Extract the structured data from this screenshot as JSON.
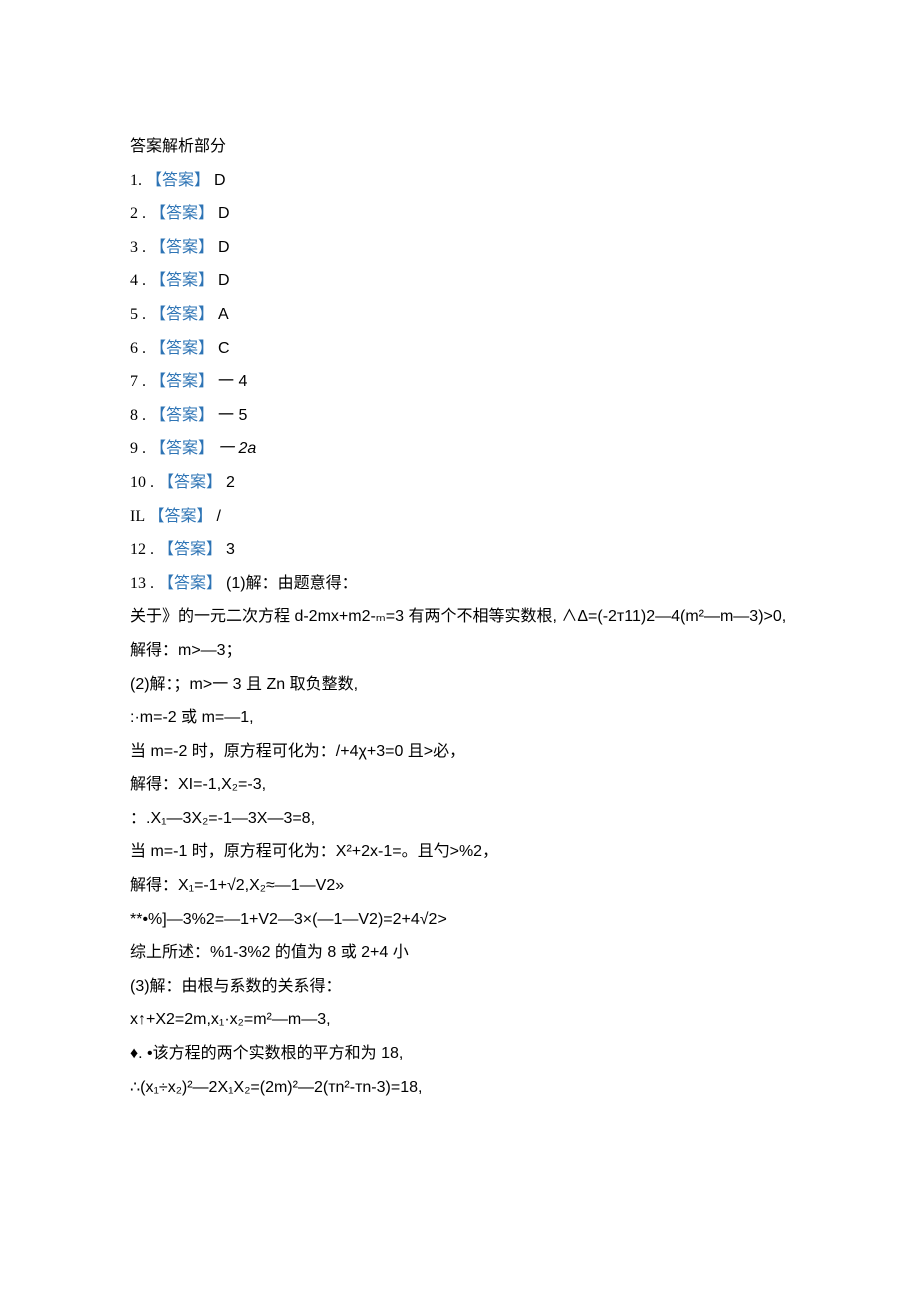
{
  "sectionTitle": "答案解析部分",
  "answers": [
    {
      "num": "1.",
      "label": "【答案】",
      "value": "D"
    },
    {
      "num": "2 .",
      "label": "【答案】",
      "value": "D"
    },
    {
      "num": "3 .",
      "label": "【答案】",
      "value": "D"
    },
    {
      "num": "4 .",
      "label": "【答案】",
      "value": "D"
    },
    {
      "num": "5 .",
      "label": "【答案】",
      "value": "A"
    },
    {
      "num": "6 .",
      "label": "【答案】",
      "value": "C"
    },
    {
      "num": "7 .",
      "label": "【答案】",
      "value": "一 4"
    },
    {
      "num": "8 .",
      "label": "【答案】",
      "value": "一 5"
    },
    {
      "num": "9 .",
      "label": "【答案】",
      "value": "一 2a"
    },
    {
      "num": "10 .",
      "label": "【答案】",
      "value": "2"
    },
    {
      "num": "IL",
      "label": "【答案】",
      "value": "/"
    },
    {
      "num": "12 .",
      "label": "【答案】",
      "value": "3"
    }
  ],
  "q13": {
    "num": "13 .",
    "label": "【答案】",
    "lines": [
      "(1)解：由题意得：",
      "关于》的一元二次方程 d-2mx+m2-ₘ=3 有两个不相等实数根, ∧Δ=(-2т11)2—4(m²—m—3)>0,",
      "解得：m>—3；",
      "(2)解：；m>一 3 且 Zn 取负整数,",
      ":·m=-2 或 m=—1,",
      "当 m=-2 时，原方程可化为：/+4χ+3=0 且>必，",
      "解得：XI=-1,X₂=-3,",
      "：.X₁—3X₂=-1—3X—3=8,",
      "当 m=-1 时，原方程可化为：X²+2x-1=。且勺>%2，",
      "解得：X₁=-1+√2,X₂≈—1—V2»",
      "**•%]—3%2=—1+V2—3×(—1—V2)=2+4√2>",
      "综上所述：%1-3%2 的值为 8 或 2+4 小",
      "(3)解：由根与系数的关系得：",
      "x↑+X2=2m,x₁·x₂=m²—m—3,",
      "♦. •该方程的两个实数根的平方和为 18,",
      "∴(x₁÷x₂)²—2X₁X₂=(2m)²—2(тn²-тn-3)=18,"
    ]
  }
}
